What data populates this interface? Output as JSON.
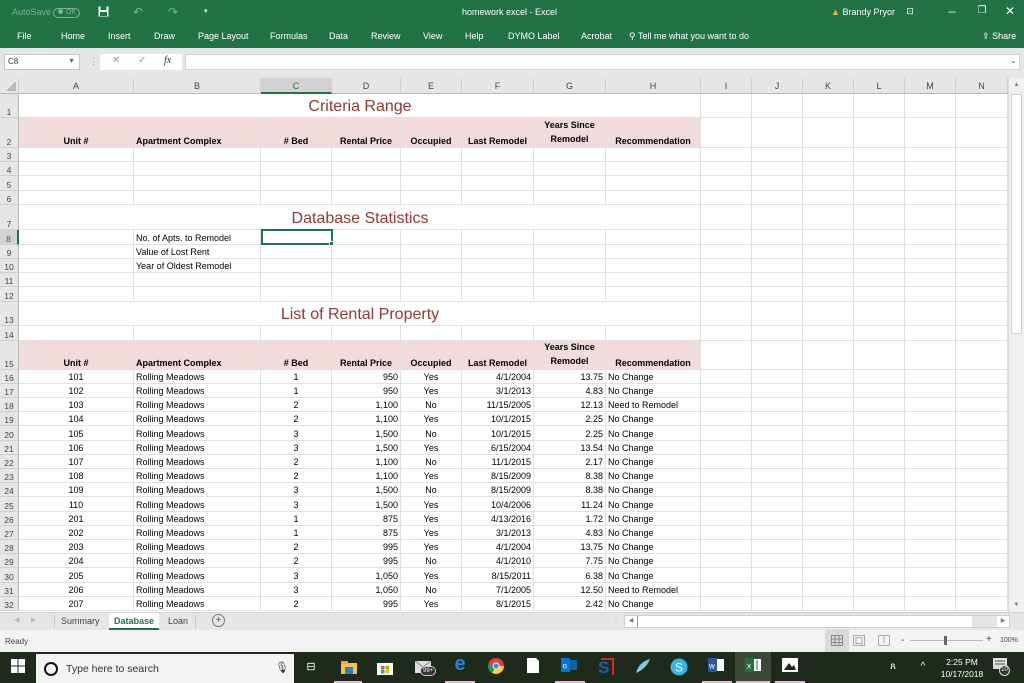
{
  "titlebar": {
    "autosave_label": "AutoSave",
    "autosave_state": "Off",
    "title": "homework excel  -  Excel",
    "user": "Brandy Pryor",
    "warning_icon": "warning-icon"
  },
  "ribbon": {
    "tabs": [
      "File",
      "Home",
      "Insert",
      "Draw",
      "Page Layout",
      "Formulas",
      "Data",
      "Review",
      "View",
      "Help",
      "DYMO Label",
      "Acrobat"
    ],
    "tell_me": "Tell me what you want to do",
    "share": "Share"
  },
  "formula_bar": {
    "name_box": "C8",
    "fx": "fx",
    "formula": ""
  },
  "columns": [
    "A",
    "B",
    "C",
    "D",
    "E",
    "F",
    "G",
    "H",
    "I",
    "J",
    "K",
    "L",
    "M",
    "N"
  ],
  "selected_column": "C",
  "selected_row": "8",
  "row_numbers": [
    "1",
    "2",
    "3",
    "4",
    "5",
    "6",
    "7",
    "8",
    "9",
    "10",
    "11",
    "12",
    "13",
    "14",
    "15",
    "16",
    "17",
    "18",
    "19",
    "20",
    "21",
    "22",
    "23",
    "24",
    "25",
    "26",
    "27",
    "28",
    "29",
    "30",
    "31",
    "32"
  ],
  "sections": {
    "criteria_title": "Criteria Range",
    "stats_title": "Database Statistics",
    "list_title": "List of Rental Property"
  },
  "table_headers": {
    "unit": "Unit #",
    "complex": "Apartment Complex",
    "bed": "# Bed",
    "price": "Rental Price",
    "occupied": "Occupied",
    "last_remodel": "Last Remodel",
    "years_since_1": "Years Since",
    "years_since_2": "Remodel",
    "recommendation": "Recommendation"
  },
  "stats_labels": [
    "No. of Apts. to Remodel",
    "Value of Lost Rent",
    "Year of Oldest Remodel"
  ],
  "rows": [
    {
      "unit": "101",
      "complex": "Rolling Meadows",
      "bed": "1",
      "price": "950",
      "occupied": "Yes",
      "last_remodel": "4/1/2004",
      "years": "13.75",
      "rec": "No Change"
    },
    {
      "unit": "102",
      "complex": "Rolling Meadows",
      "bed": "1",
      "price": "950",
      "occupied": "Yes",
      "last_remodel": "3/1/2013",
      "years": "4.83",
      "rec": "No Change"
    },
    {
      "unit": "103",
      "complex": "Rolling Meadows",
      "bed": "2",
      "price": "1,100",
      "occupied": "No",
      "last_remodel": "11/15/2005",
      "years": "12.13",
      "rec": "Need to Remodel"
    },
    {
      "unit": "104",
      "complex": "Rolling Meadows",
      "bed": "2",
      "price": "1,100",
      "occupied": "Yes",
      "last_remodel": "10/1/2015",
      "years": "2.25",
      "rec": "No Change"
    },
    {
      "unit": "105",
      "complex": "Rolling Meadows",
      "bed": "3",
      "price": "1,500",
      "occupied": "No",
      "last_remodel": "10/1/2015",
      "years": "2.25",
      "rec": "No Change"
    },
    {
      "unit": "106",
      "complex": "Rolling Meadows",
      "bed": "3",
      "price": "1,500",
      "occupied": "Yes",
      "last_remodel": "6/15/2004",
      "years": "13.54",
      "rec": "No Change"
    },
    {
      "unit": "107",
      "complex": "Rolling Meadows",
      "bed": "2",
      "price": "1,100",
      "occupied": "No",
      "last_remodel": "11/1/2015",
      "years": "2.17",
      "rec": "No Change"
    },
    {
      "unit": "108",
      "complex": "Rolling Meadows",
      "bed": "2",
      "price": "1,100",
      "occupied": "Yes",
      "last_remodel": "8/15/2009",
      "years": "8.38",
      "rec": "No Change"
    },
    {
      "unit": "109",
      "complex": "Rolling Meadows",
      "bed": "3",
      "price": "1,500",
      "occupied": "No",
      "last_remodel": "8/15/2009",
      "years": "8.38",
      "rec": "No Change"
    },
    {
      "unit": "110",
      "complex": "Rolling Meadows",
      "bed": "3",
      "price": "1,500",
      "occupied": "Yes",
      "last_remodel": "10/4/2006",
      "years": "11.24",
      "rec": "No Change"
    },
    {
      "unit": "201",
      "complex": "Rolling Meadows",
      "bed": "1",
      "price": "875",
      "occupied": "Yes",
      "last_remodel": "4/13/2016",
      "years": "1.72",
      "rec": "No Change"
    },
    {
      "unit": "202",
      "complex": "Rolling Meadows",
      "bed": "1",
      "price": "875",
      "occupied": "Yes",
      "last_remodel": "3/1/2013",
      "years": "4.83",
      "rec": "No Change"
    },
    {
      "unit": "203",
      "complex": "Rolling Meadows",
      "bed": "2",
      "price": "995",
      "occupied": "Yes",
      "last_remodel": "4/1/2004",
      "years": "13.75",
      "rec": "No Change"
    },
    {
      "unit": "204",
      "complex": "Rolling Meadows",
      "bed": "2",
      "price": "995",
      "occupied": "No",
      "last_remodel": "4/1/2010",
      "years": "7.75",
      "rec": "No Change"
    },
    {
      "unit": "205",
      "complex": "Rolling Meadows",
      "bed": "3",
      "price": "1,050",
      "occupied": "Yes",
      "last_remodel": "8/15/2011",
      "years": "6.38",
      "rec": "No Change"
    },
    {
      "unit": "206",
      "complex": "Rolling Meadows",
      "bed": "3",
      "price": "1,050",
      "occupied": "No",
      "last_remodel": "7/1/2005",
      "years": "12.50",
      "rec": "Need to Remodel"
    },
    {
      "unit": "207",
      "complex": "Rolling Meadows",
      "bed": "2",
      "price": "995",
      "occupied": "Yes",
      "last_remodel": "8/1/2015",
      "years": "2.42",
      "rec": "No Change"
    }
  ],
  "sheet_tabs": [
    "Summary",
    "Database",
    "Loan"
  ],
  "active_sheet": "Database",
  "status": {
    "ready": "Ready",
    "zoom": "100%",
    "zoom_level_percent": 100
  },
  "taskbar": {
    "search_placeholder": "Type here to search",
    "mail_badge": "99+",
    "time": "2:25 PM",
    "date": "10/17/2018",
    "notification_count": "10"
  },
  "colors": {
    "excel_green": "#217346",
    "header_pink": "#f2dcdb",
    "title_red": "#953735"
  }
}
